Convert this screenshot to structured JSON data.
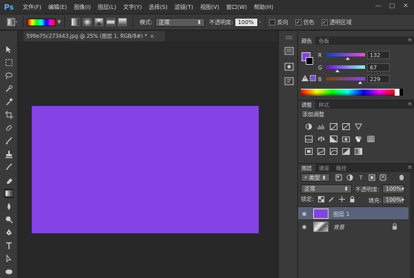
{
  "app": {
    "logo": "Ps"
  },
  "menu": {
    "items": [
      "文件(F)",
      "编辑(E)",
      "图像(I)",
      "图层(L)",
      "文字(Y)",
      "选择(S)",
      "滤镜(T)",
      "视图(V)",
      "窗口(W)",
      "帮助(H)"
    ]
  },
  "window_controls": {
    "minimize": "—",
    "maximize": "□",
    "close": "✕"
  },
  "options": {
    "mode_label": "模式:",
    "mode_value": "正常",
    "opacity_label": "不透明度:",
    "opacity_value": "100%",
    "reverse_label": "反向",
    "dither_label": "仿色",
    "transparency_label": "透明区域",
    "reverse_checked": false,
    "dither_checked": true,
    "transparency_checked": true
  },
  "document": {
    "tab_title": "599e75c273443.jpg @ 25% (图层 1, RGB/8#) *",
    "close": "×",
    "fill_color": "#8443e5"
  },
  "color_panel": {
    "tabs": [
      "颜色",
      "色板"
    ],
    "fg_color": "#8443e5",
    "bg_color": "#000000",
    "channels": [
      {
        "label": "R",
        "value": "132"
      },
      {
        "label": "G",
        "value": "67"
      },
      {
        "label": "B",
        "value": "229"
      }
    ]
  },
  "adjustments_panel": {
    "tabs": [
      "调整",
      "样式"
    ],
    "title": "添加调整"
  },
  "layers_panel": {
    "tabs": [
      "图层",
      "通道",
      "路径"
    ],
    "kind_label": "类型",
    "blend_mode": "正常",
    "opacity_label": "不透明度:",
    "opacity_value": "100%",
    "lock_label": "锁定:",
    "fill_label": "填充:",
    "fill_value": "100%",
    "layers": [
      {
        "name": "图层 1",
        "selected": true,
        "thumb": "#8443e5"
      },
      {
        "name": "背景",
        "selected": false,
        "locked": true
      }
    ]
  },
  "accent": {
    "selection": "#596279",
    "purple": "#8443e5",
    "ps_blue": "#4fb2f2"
  }
}
